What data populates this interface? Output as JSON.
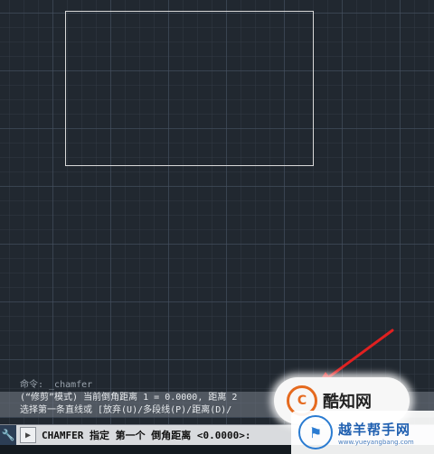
{
  "history": {
    "line1": "命令: _chamfer",
    "line2": "(“修剪”模式) 当前倒角距离 1 = 0.0000, 距离 2",
    "line3": "选择第一条直线或 [放弃(U)/多段线(P)/距离(D)/"
  },
  "command_line": {
    "text": "CHAMFER 指定 第一个 倒角距离 <0.0000>:"
  },
  "icons": {
    "wrench": "wrench-icon",
    "prompt": "command-prompt-icon"
  },
  "watermark_1": {
    "logo_char": "C",
    "name": "酷知网"
  },
  "watermark_2": {
    "logo_char": "⚑",
    "title": "越羊帮手网",
    "url": "www.yueyangbang.com"
  },
  "colors": {
    "canvas_bg": "#212830",
    "arrow": "#e02020"
  }
}
